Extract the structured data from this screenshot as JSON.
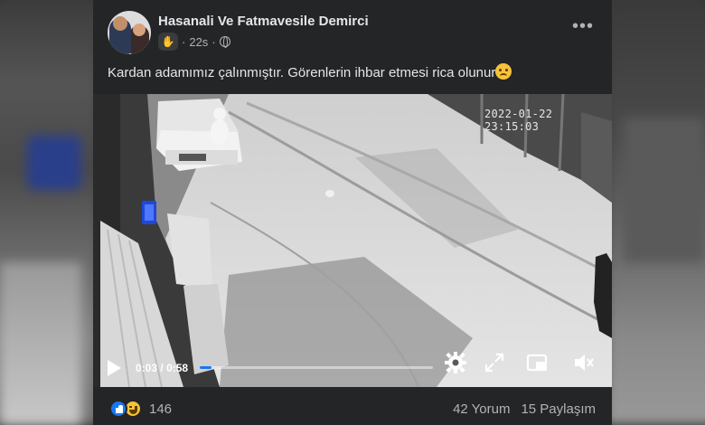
{
  "post": {
    "author": "Hasanali Ve Fatmavesile Demirci",
    "time": "22s",
    "text": "Kardan adamımız çalınmıştır. Görenlerin ihbar etmesi rica olunur"
  },
  "video": {
    "timestamp": "2022-01-22 23:15:03",
    "current_time": "0:03",
    "separator": "/",
    "duration": "0:58",
    "progress_fraction": 0.05
  },
  "footer": {
    "reaction_count": "146",
    "comments": "42 Yorum",
    "shares": "15 Paylaşım"
  },
  "colors": {
    "card_bg": "#242526",
    "accent": "#1877f2",
    "text_primary": "#e4e6eb",
    "text_secondary": "#b0b3b8"
  },
  "icons": [
    "wave-icon",
    "globe-icon",
    "more-options-icon",
    "play-icon",
    "settings-icon",
    "fullscreen-icon",
    "picture-in-picture-icon",
    "mute-icon",
    "like-reaction-icon",
    "haha-reaction-icon",
    "sad-emoji-icon"
  ]
}
